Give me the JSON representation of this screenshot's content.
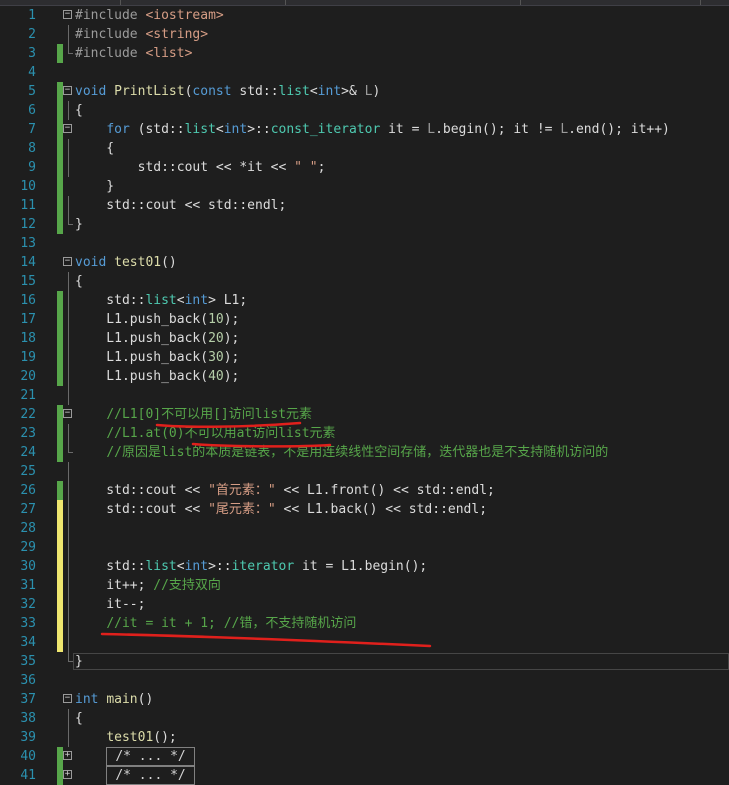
{
  "lines": [
    {
      "n": "1",
      "parts": [
        {
          "t": "#include ",
          "c": "pp"
        },
        {
          "t": "<iostream>",
          "c": "inc"
        }
      ]
    },
    {
      "n": "2",
      "parts": [
        {
          "t": "#include ",
          "c": "pp"
        },
        {
          "t": "<string>",
          "c": "inc"
        }
      ]
    },
    {
      "n": "3",
      "parts": [
        {
          "t": "#include ",
          "c": "pp"
        },
        {
          "t": "<list>",
          "c": "inc"
        }
      ]
    },
    {
      "n": "4",
      "parts": []
    },
    {
      "n": "5",
      "parts": [
        {
          "t": "void",
          "c": "kw"
        },
        {
          "t": " "
        },
        {
          "t": "PrintList",
          "c": "fn"
        },
        {
          "t": "("
        },
        {
          "t": "const",
          "c": "kw"
        },
        {
          "t": " std::"
        },
        {
          "t": "list",
          "c": "ty"
        },
        {
          "t": "<"
        },
        {
          "t": "int",
          "c": "kw"
        },
        {
          "t": ">& "
        },
        {
          "t": "L",
          "c": "pm"
        },
        {
          "t": ")"
        }
      ]
    },
    {
      "n": "6",
      "parts": [
        {
          "t": "{"
        }
      ]
    },
    {
      "n": "7",
      "parts": [
        {
          "t": "    "
        },
        {
          "t": "for",
          "c": "kw"
        },
        {
          "t": " (std::"
        },
        {
          "t": "list",
          "c": "ty"
        },
        {
          "t": "<"
        },
        {
          "t": "int",
          "c": "kw"
        },
        {
          "t": ">::"
        },
        {
          "t": "const_iterator",
          "c": "ty"
        },
        {
          "t": " it = "
        },
        {
          "t": "L",
          "c": "pm"
        },
        {
          "t": ".begin(); it != "
        },
        {
          "t": "L",
          "c": "pm"
        },
        {
          "t": ".end(); it++)"
        }
      ]
    },
    {
      "n": "8",
      "parts": [
        {
          "t": "    {"
        }
      ]
    },
    {
      "n": "9",
      "parts": [
        {
          "t": "        std::cout << *it << "
        },
        {
          "t": "\" \"",
          "c": "str"
        },
        {
          "t": ";"
        }
      ]
    },
    {
      "n": "10",
      "parts": [
        {
          "t": "    }"
        }
      ]
    },
    {
      "n": "11",
      "parts": [
        {
          "t": "    std::cout << std::endl;"
        }
      ]
    },
    {
      "n": "12",
      "parts": [
        {
          "t": "}"
        }
      ]
    },
    {
      "n": "13",
      "parts": []
    },
    {
      "n": "14",
      "parts": [
        {
          "t": "void",
          "c": "kw"
        },
        {
          "t": " "
        },
        {
          "t": "test01",
          "c": "fn"
        },
        {
          "t": "()"
        }
      ]
    },
    {
      "n": "15",
      "parts": [
        {
          "t": "{"
        }
      ]
    },
    {
      "n": "16",
      "parts": [
        {
          "t": "    std::"
        },
        {
          "t": "list",
          "c": "ty"
        },
        {
          "t": "<"
        },
        {
          "t": "int",
          "c": "kw"
        },
        {
          "t": "> L1;"
        }
      ]
    },
    {
      "n": "17",
      "parts": [
        {
          "t": "    L1.push_back("
        },
        {
          "t": "10",
          "c": "num"
        },
        {
          "t": ");"
        }
      ]
    },
    {
      "n": "18",
      "parts": [
        {
          "t": "    L1.push_back("
        },
        {
          "t": "20",
          "c": "num"
        },
        {
          "t": ");"
        }
      ]
    },
    {
      "n": "19",
      "parts": [
        {
          "t": "    L1.push_back("
        },
        {
          "t": "30",
          "c": "num"
        },
        {
          "t": ");"
        }
      ]
    },
    {
      "n": "20",
      "parts": [
        {
          "t": "    L1.push_back("
        },
        {
          "t": "40",
          "c": "num"
        },
        {
          "t": ");"
        }
      ]
    },
    {
      "n": "21",
      "parts": []
    },
    {
      "n": "22",
      "parts": [
        {
          "t": "    "
        },
        {
          "t": "//L1[0]不可以用[]访问list元素",
          "c": "cm"
        }
      ]
    },
    {
      "n": "23",
      "parts": [
        {
          "t": "    "
        },
        {
          "t": "//L1.at(0)不可以用at访问list元素",
          "c": "cm"
        }
      ]
    },
    {
      "n": "24",
      "parts": [
        {
          "t": "    "
        },
        {
          "t": "//原因是list的本质是链表，不是用连续线性空间存储，迭代器也是不支持随机访问的",
          "c": "cm"
        }
      ]
    },
    {
      "n": "25",
      "parts": []
    },
    {
      "n": "26",
      "parts": [
        {
          "t": "    std::cout << "
        },
        {
          "t": "\"首元素：\"",
          "c": "str"
        },
        {
          "t": " << L1.front() << std::endl;"
        }
      ]
    },
    {
      "n": "27",
      "parts": [
        {
          "t": "    std::cout << "
        },
        {
          "t": "\"尾元素：\"",
          "c": "str"
        },
        {
          "t": " << L1.back() << std::endl;"
        }
      ]
    },
    {
      "n": "28",
      "parts": []
    },
    {
      "n": "29",
      "parts": []
    },
    {
      "n": "30",
      "parts": [
        {
          "t": "    std::"
        },
        {
          "t": "list",
          "c": "ty"
        },
        {
          "t": "<"
        },
        {
          "t": "int",
          "c": "kw"
        },
        {
          "t": ">::"
        },
        {
          "t": "iterator",
          "c": "ty"
        },
        {
          "t": " it = L1.begin();"
        }
      ]
    },
    {
      "n": "31",
      "parts": [
        {
          "t": "    it++; "
        },
        {
          "t": "//支持双向",
          "c": "cm"
        }
      ]
    },
    {
      "n": "32",
      "parts": [
        {
          "t": "    it--;"
        }
      ]
    },
    {
      "n": "33",
      "parts": [
        {
          "t": "    "
        },
        {
          "t": "//it = it + 1; //错，不支持随机访问",
          "c": "cm"
        }
      ]
    },
    {
      "n": "34",
      "parts": []
    },
    {
      "n": "35",
      "parts": [
        {
          "t": "}"
        }
      ]
    },
    {
      "n": "36",
      "parts": []
    },
    {
      "n": "37",
      "parts": [
        {
          "t": "int",
          "c": "kw"
        },
        {
          "t": " "
        },
        {
          "t": "main",
          "c": "fn"
        },
        {
          "t": "()"
        }
      ]
    },
    {
      "n": "38",
      "parts": [
        {
          "t": "{"
        }
      ]
    },
    {
      "n": "39",
      "parts": [
        {
          "t": "    "
        },
        {
          "t": "test01",
          "c": "fn"
        },
        {
          "t": "();"
        }
      ]
    },
    {
      "n": "40",
      "parts": [
        {
          "t": "    "
        },
        {
          "t": "/* ... */",
          "box": true
        }
      ]
    },
    {
      "n": "41",
      "parts": [
        {
          "t": "    "
        },
        {
          "t": "/* ... */",
          "box": true
        }
      ]
    }
  ],
  "colors": {
    "background": "#1e1e1e",
    "line_number": "#2b91af",
    "keyword": "#569cd6",
    "type": "#4ec9b0",
    "string": "#d69d85",
    "comment": "#57a64a",
    "changed_saved": "#57a64a",
    "changed_unsaved": "#efe66f",
    "annotation": "#e0201c"
  },
  "icons": [
    "fold-collapse-icon",
    "fold-expand-icon"
  ]
}
